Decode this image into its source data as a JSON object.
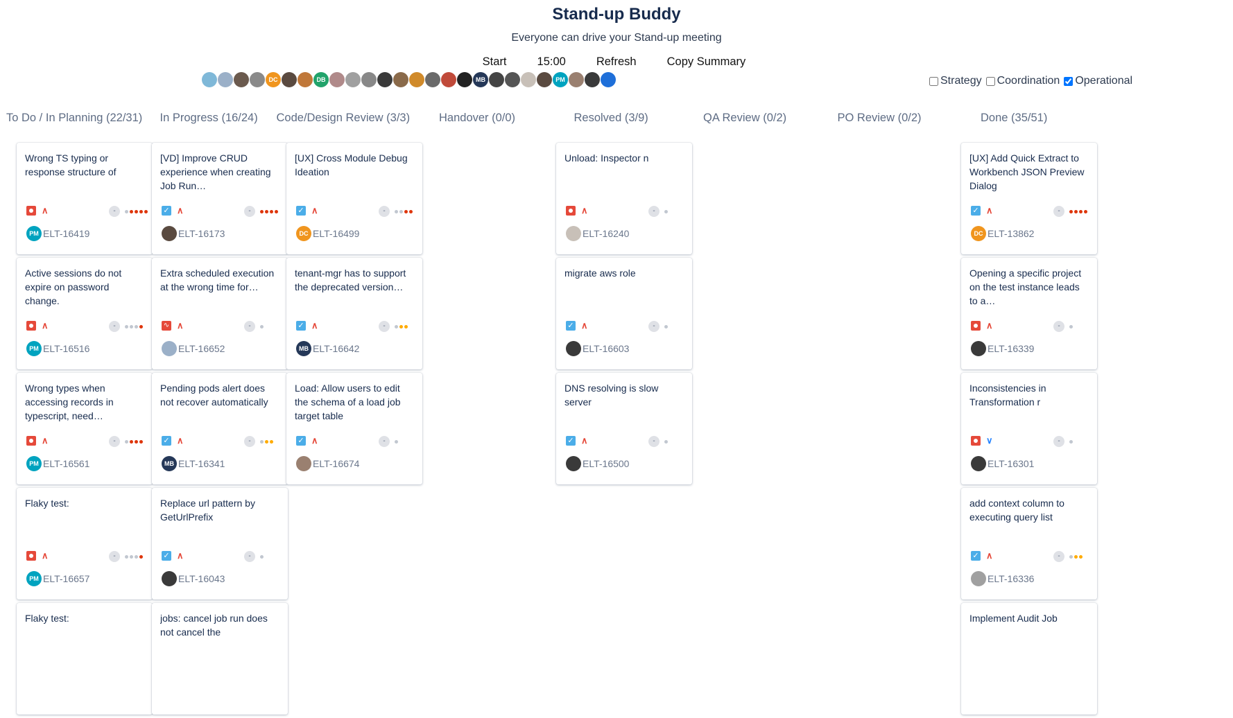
{
  "header": {
    "title": "Stand-up Buddy",
    "subtitle": "Everyone can drive your Stand-up meeting",
    "start_label": "Start",
    "timer": "15:00",
    "refresh_label": "Refresh",
    "copy_label": "Copy Summary"
  },
  "participants": [
    {
      "initials": "",
      "color": "#7fb8d8"
    },
    {
      "initials": "",
      "color": "#9bb0c8"
    },
    {
      "initials": "",
      "color": "#6b5a4e"
    },
    {
      "initials": "",
      "color": "#8a8a8a"
    },
    {
      "initials": "DC",
      "color": "#f0951e"
    },
    {
      "initials": "",
      "color": "#5a4a40"
    },
    {
      "initials": "",
      "color": "#c0783a"
    },
    {
      "initials": "DB",
      "color": "#22a36b"
    },
    {
      "initials": "",
      "color": "#b08a8a"
    },
    {
      "initials": "",
      "color": "#a0a0a0"
    },
    {
      "initials": "",
      "color": "#888888"
    },
    {
      "initials": "",
      "color": "#3a3a3a"
    },
    {
      "initials": "",
      "color": "#8a6a4a"
    },
    {
      "initials": "",
      "color": "#d08a2a"
    },
    {
      "initials": "",
      "color": "#6a6a6a"
    },
    {
      "initials": "",
      "color": "#c04a3a"
    },
    {
      "initials": "",
      "color": "#222222"
    },
    {
      "initials": "MB",
      "color": "#253858"
    },
    {
      "initials": "",
      "color": "#444444"
    },
    {
      "initials": "",
      "color": "#555555"
    },
    {
      "initials": "",
      "color": "#c8c0b8"
    },
    {
      "initials": "",
      "color": "#5a4a40"
    },
    {
      "initials": "PM",
      "color": "#00a3bf"
    },
    {
      "initials": "",
      "color": "#9a8070"
    },
    {
      "initials": "",
      "color": "#3a3a3a"
    },
    {
      "initials": "",
      "color": "#1e6fd9"
    }
  ],
  "filters": {
    "strategy": {
      "label": "Strategy",
      "checked": false
    },
    "coordination": {
      "label": "Coordination",
      "checked": false
    },
    "operational": {
      "label": "Operational",
      "checked": true
    }
  },
  "columns": [
    {
      "title": "To Do / In Planning (22/31)",
      "cards": [
        {
          "title": "Wrong TS typing or response structure of",
          "key": "ELT-16419",
          "type": "bug",
          "prio": "high",
          "dots": [
            "#c1c7d0",
            "#de350b",
            "#de350b",
            "#de350b",
            "#de350b"
          ],
          "avatar": {
            "initials": "PM",
            "color": "#00a3bf"
          }
        },
        {
          "title": "Active sessions do not expire on password change.",
          "key": "ELT-16516",
          "type": "bug",
          "prio": "high",
          "dots": [
            "#c1c7d0",
            "#c1c7d0",
            "#c1c7d0",
            "#de350b"
          ],
          "avatar": {
            "initials": "PM",
            "color": "#00a3bf"
          }
        },
        {
          "title": "Wrong types when accessing records in typescript, need…",
          "key": "ELT-16561",
          "type": "bug",
          "prio": "high",
          "dots": [
            "#c1c7d0",
            "#de350b",
            "#de350b",
            "#de350b"
          ],
          "avatar": {
            "initials": "PM",
            "color": "#00a3bf"
          }
        },
        {
          "title": "Flaky test:",
          "key": "ELT-16657",
          "type": "bug",
          "prio": "high",
          "dots": [
            "#c1c7d0",
            "#c1c7d0",
            "#c1c7d0",
            "#de350b"
          ],
          "avatar": {
            "initials": "PM",
            "color": "#00a3bf"
          }
        },
        {
          "title": "Flaky test:",
          "key": "",
          "type": "bug",
          "prio": "high",
          "dots": [],
          "avatar": {
            "initials": "",
            "color": "#ffffff"
          }
        }
      ]
    },
    {
      "title": "In Progress (16/24)",
      "cards": [
        {
          "title": "[VD] Improve CRUD experience when creating Job Run…",
          "key": "ELT-16173",
          "type": "task",
          "prio": "high",
          "dots": [
            "#de350b",
            "#de350b",
            "#de350b",
            "#de350b"
          ],
          "avatar": {
            "initials": "",
            "color": "#5a4a40"
          }
        },
        {
          "title": "Extra scheduled execution at the wrong time for…",
          "key": "ELT-16652",
          "type": "incident",
          "prio": "high",
          "dots": [
            "#c1c7d0"
          ],
          "avatar": {
            "initials": "",
            "color": "#9bb0c8"
          }
        },
        {
          "title": "Pending pods alert does not recover automatically",
          "key": "ELT-16341",
          "type": "task",
          "prio": "high",
          "dots": [
            "#c1c7d0",
            "#ffab00",
            "#ffab00"
          ],
          "avatar": {
            "initials": "MB",
            "color": "#253858"
          }
        },
        {
          "title": "Replace url pattern by GetUrlPrefix",
          "key": "ELT-16043",
          "type": "task",
          "prio": "high",
          "dots": [
            "#c1c7d0"
          ],
          "avatar": {
            "initials": "",
            "color": "#3a3a3a"
          }
        },
        {
          "title": "jobs: cancel job run does not cancel the",
          "key": "",
          "type": "task",
          "prio": "high",
          "dots": [],
          "avatar": {
            "initials": "",
            "color": "#ffffff"
          }
        }
      ]
    },
    {
      "title": "Code/Design Review (3/3)",
      "cards": [
        {
          "title": "[UX] Cross Module Debug Ideation",
          "key": "ELT-16499",
          "type": "task",
          "prio": "high",
          "dots": [
            "#c1c7d0",
            "#c1c7d0",
            "#de350b",
            "#de350b"
          ],
          "avatar": {
            "initials": "DC",
            "color": "#f0951e"
          }
        },
        {
          "title": "tenant-mgr has to support the deprecated version…",
          "key": "ELT-16642",
          "type": "task",
          "prio": "high",
          "dots": [
            "#c1c7d0",
            "#ffab00",
            "#ffab00"
          ],
          "avatar": {
            "initials": "MB",
            "color": "#253858"
          }
        },
        {
          "title": "Load: Allow users to edit the schema of a load job target table",
          "key": "ELT-16674",
          "type": "task",
          "prio": "high",
          "dots": [
            "#c1c7d0"
          ],
          "avatar": {
            "initials": "",
            "color": "#9a8070"
          }
        }
      ]
    },
    {
      "title": "Handover (0/0)",
      "cards": []
    },
    {
      "title": "Resolved (3/9)",
      "cards": [
        {
          "title": "Unload: Inspector n",
          "key": "ELT-16240",
          "type": "bug",
          "prio": "high",
          "dots": [
            "#c1c7d0"
          ],
          "avatar": {
            "initials": "",
            "color": "#c8c0b8"
          }
        },
        {
          "title": "migrate aws role",
          "key": "ELT-16603",
          "type": "task",
          "prio": "high",
          "dots": [
            "#c1c7d0"
          ],
          "avatar": {
            "initials": "",
            "color": "#3a3a3a"
          }
        },
        {
          "title": "DNS resolving is slow server",
          "key": "ELT-16500",
          "type": "task",
          "prio": "high",
          "dots": [
            "#c1c7d0"
          ],
          "avatar": {
            "initials": "",
            "color": "#3a3a3a"
          }
        }
      ]
    },
    {
      "title": "QA Review (0/2)",
      "cards": []
    },
    {
      "title": "PO Review (0/2)",
      "cards": []
    },
    {
      "title": "Done (35/51)",
      "cards": [
        {
          "title": "[UX] Add Quick Extract to Workbench JSON Preview Dialog",
          "key": "ELT-13862",
          "type": "task",
          "prio": "high",
          "dots": [
            "#de350b",
            "#de350b",
            "#de350b",
            "#de350b"
          ],
          "avatar": {
            "initials": "DC",
            "color": "#f0951e"
          }
        },
        {
          "title": "Opening a specific project on the test instance leads to a…",
          "key": "ELT-16339",
          "type": "bug",
          "prio": "high",
          "dots": [
            "#c1c7d0"
          ],
          "avatar": {
            "initials": "",
            "color": "#3a3a3a"
          }
        },
        {
          "title": "Inconsistencies in Transformation r",
          "key": "ELT-16301",
          "type": "bug",
          "prio": "low",
          "dots": [
            "#c1c7d0"
          ],
          "avatar": {
            "initials": "",
            "color": "#3a3a3a"
          }
        },
        {
          "title": "add context column to executing query list",
          "key": "ELT-16336",
          "type": "task",
          "prio": "high",
          "dots": [
            "#c1c7d0",
            "#ffab00",
            "#ffab00"
          ],
          "avatar": {
            "initials": "",
            "color": "#a0a0a0"
          }
        },
        {
          "title": "Implement Audit Job",
          "key": "",
          "type": "task",
          "prio": "high",
          "dots": [],
          "avatar": {
            "initials": "",
            "color": "#ffffff"
          }
        }
      ]
    }
  ]
}
